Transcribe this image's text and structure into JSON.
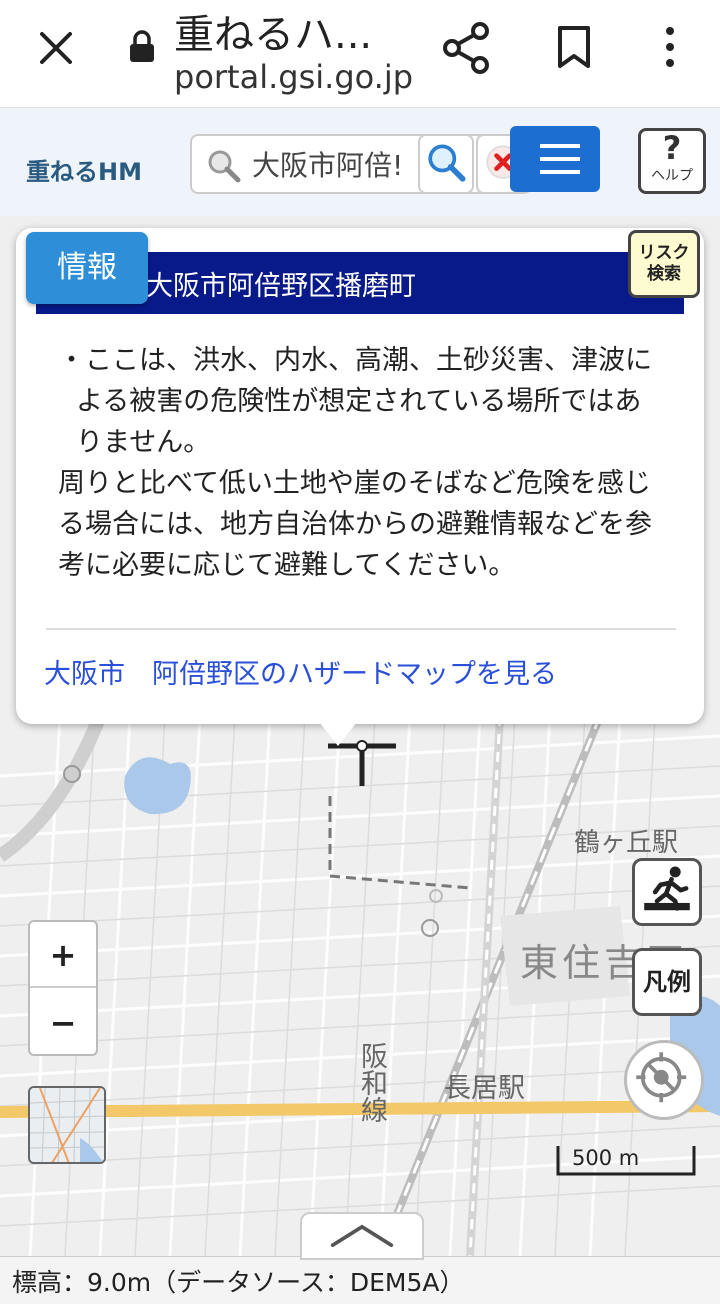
{
  "browser": {
    "title": "重ねるハ...",
    "url": "portal.gsi.go.jp"
  },
  "header": {
    "logo": "重ねるHM",
    "search_value": "大阪市阿倍!",
    "help_label": "ヘルプ"
  },
  "info_tab_label": "情報",
  "risk_button": {
    "line1": "リスク",
    "line2": "検索"
  },
  "popup": {
    "place_name": "大阪市阿倍野区播磨町",
    "body_lines": [
      "・ここは、洪水、内水、高潮、土砂災害、津波による被害の危険性が想定されている場所ではありません。",
      "周りと比べて低い土地や崖のそばなど危険を感じる場合には、地方自治体からの避難情報などを参考に必要に応じて避難してください。"
    ],
    "link_text": "大阪市　阿倍野区のハザードマップを見る"
  },
  "map": {
    "labels": {
      "station_tsurugaoka": "鶴ヶ丘駅",
      "district_higashisumiyoshi": "東住吉区",
      "station_nagai": "長居駅",
      "line_hanwa": "阪和線"
    },
    "zoom_in": "+",
    "zoom_out": "−",
    "legend_label": "凡例",
    "scale_label": "500 m"
  },
  "footer": {
    "elevation_text": "標高：9.0m（データソース：DEM5A）"
  },
  "colors": {
    "popup_header_bg": "#081a8a",
    "info_tab_bg": "#2e8fd8",
    "menu_button_bg": "#1c6fd1",
    "link_color": "#2a4fd8",
    "risk_button_bg": "#fffbd0"
  }
}
